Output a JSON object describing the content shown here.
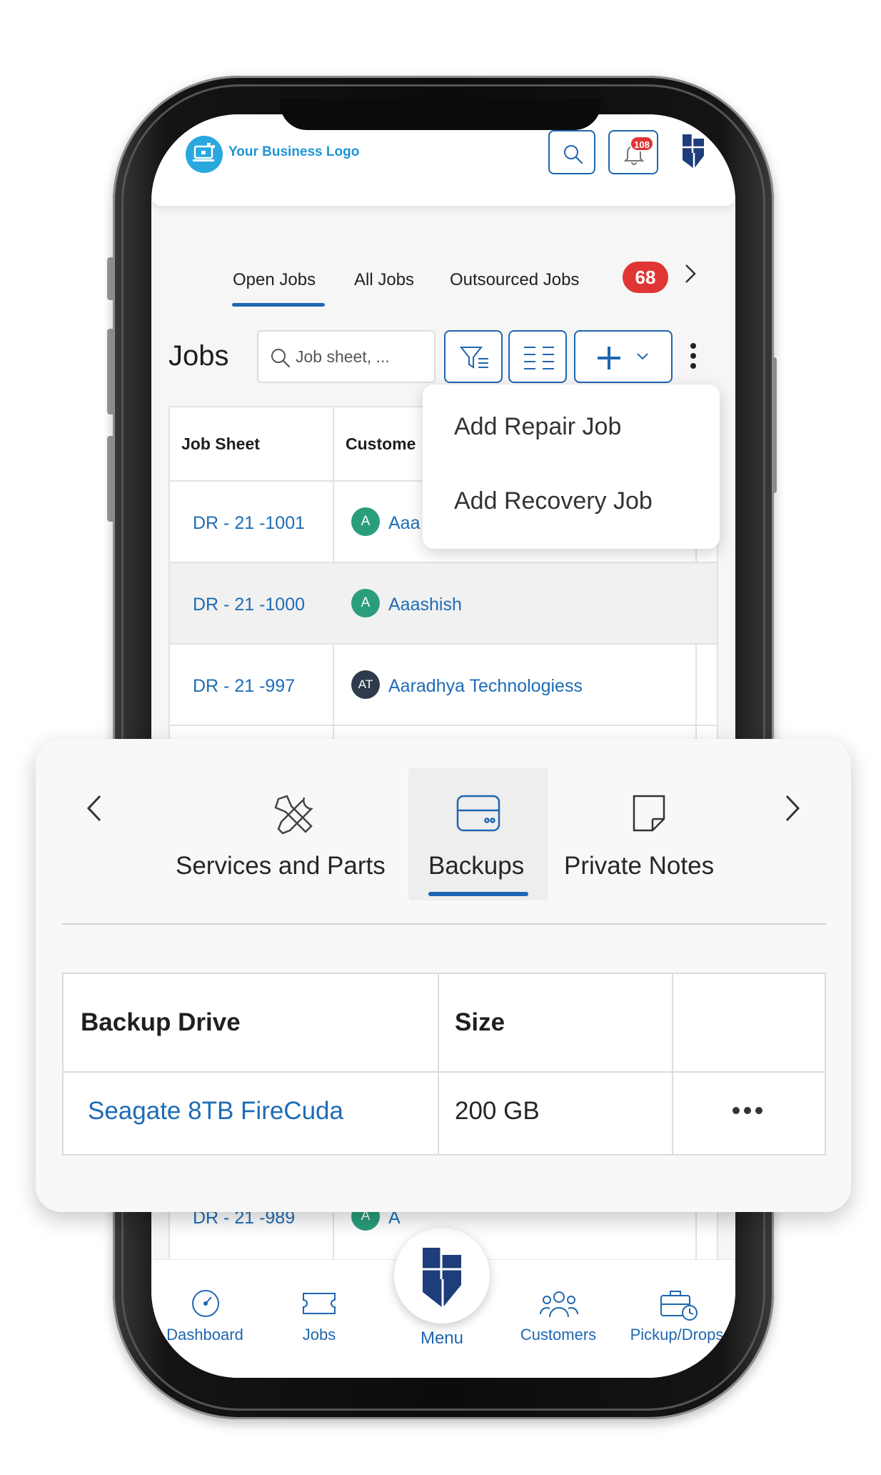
{
  "header": {
    "logo_text": "Your Business Logo",
    "notification_count": "108"
  },
  "tabs": [
    {
      "label": "Open Jobs",
      "active": true
    },
    {
      "label": "All Jobs",
      "active": false
    },
    {
      "label": "Outsourced Jobs",
      "active": false
    }
  ],
  "tab_count_badge": "68",
  "jobs": {
    "title": "Jobs",
    "search_placeholder": "Job sheet, ..."
  },
  "table": {
    "headers": [
      "Job Sheet",
      "Custome"
    ],
    "rows": [
      {
        "job_sheet": "DR - 21 -1001",
        "avatar": "A",
        "customer": "Aaa"
      },
      {
        "job_sheet": "DR - 21 -1000",
        "avatar": "A",
        "customer": "Aaashish"
      },
      {
        "job_sheet": "DR - 21 -997",
        "avatar": "AT",
        "customer": "Aaradhya Technologiess"
      },
      {
        "job_sheet": "DR - 21 -989",
        "avatar": "A",
        "customer": "A"
      }
    ]
  },
  "add_menu": {
    "items": [
      "Add Repair Job",
      "Add Recovery Job"
    ]
  },
  "bottom_nav": {
    "items": [
      "Dashboard",
      "Jobs",
      "Menu",
      "Customers",
      "Pickup/Drops"
    ]
  },
  "detail_card": {
    "tabs": [
      {
        "label": "Services and Parts",
        "icon": "tools-icon",
        "active": false
      },
      {
        "label": "Backups",
        "icon": "drive-icon",
        "active": true
      },
      {
        "label": "Private Notes",
        "icon": "note-icon",
        "active": false
      }
    ],
    "table": {
      "headers": [
        "Backup Drive",
        "Size",
        ""
      ],
      "rows": [
        {
          "drive": "Seagate 8TB FireCuda",
          "size": "200 GB"
        }
      ]
    }
  },
  "colors": {
    "accent": "#1e66b1",
    "link": "#1e6cb5",
    "badge": "#e03535",
    "avatar_green": "#2a9d7c",
    "avatar_dark": "#2f3b4c"
  }
}
